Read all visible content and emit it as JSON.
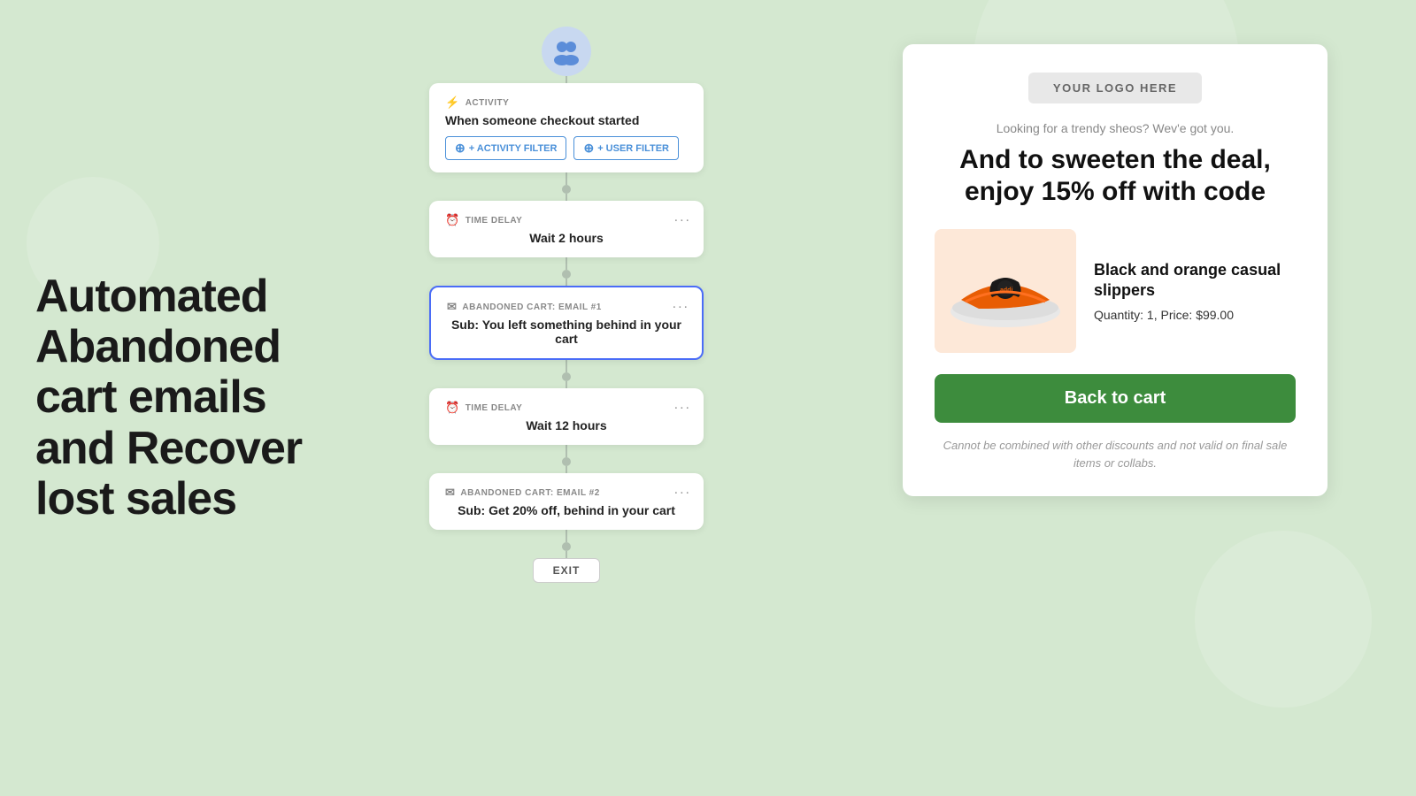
{
  "background_color": "#d4e8d0",
  "hero": {
    "title_line1": "Automated",
    "title_line2": "Abandoned",
    "title_line3": "cart emails",
    "title_line4": "and Recover",
    "title_line5": "lost sales"
  },
  "workflow": {
    "avatar_icon": "👥",
    "activity_card": {
      "label": "ACTIVITY",
      "label_icon": "⚡",
      "value": "When someone checkout started",
      "filter1_label": "+ ACTIVITY FILTER",
      "filter2_label": "+ USER FILTER"
    },
    "time_delay_1": {
      "label": "TIME DELAY",
      "label_icon": "⏰",
      "value": "Wait 2 hours",
      "menu": "..."
    },
    "email_1": {
      "label": "ABANDONED CART: EMAIL #1",
      "label_icon": "✉",
      "value": "Sub: You left something behind in your cart",
      "menu": "...",
      "highlighted": true
    },
    "time_delay_2": {
      "label": "TIME DELAY",
      "label_icon": "⏰",
      "value": "Wait 12 hours",
      "menu": "..."
    },
    "email_2": {
      "label": "ABANDONED CART: EMAIL #2",
      "label_icon": "✉",
      "value": "Sub: Get 20% off, behind in your cart",
      "menu": "..."
    },
    "exit_label": "EXIT"
  },
  "email_preview": {
    "logo_text": "YOUR LOGO HERE",
    "subtitle": "Looking for a trendy sheos? Wev'e got you.",
    "headline": "And to sweeten the deal, enjoy 15% off with code",
    "product": {
      "name": "Black and orange casual slippers",
      "quantity_label": "Quantity:",
      "quantity": "1",
      "price_label": "Price:",
      "price": "$99.00"
    },
    "cta_label": "Back to cart",
    "disclaimer": "Cannot be combined with other discounts and not valid on final sale items or collabs."
  }
}
